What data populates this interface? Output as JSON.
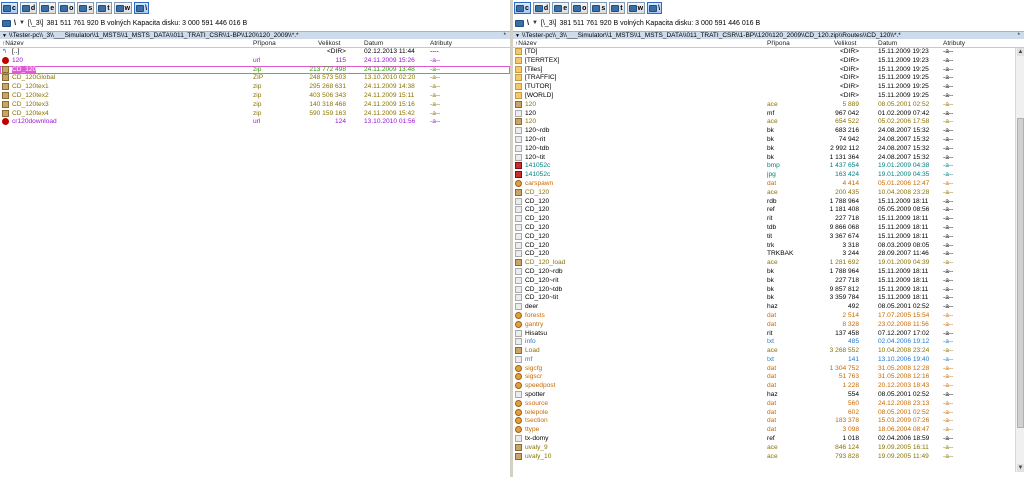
{
  "colors": {
    "default": "#000000",
    "green": "#2a9d00",
    "purple": "#9b14d8",
    "olive": "#8a7300",
    "orange": "#c86a00",
    "blue": "#1f78d0",
    "teal": "#008080"
  },
  "left": {
    "drives": [
      {
        "letter": "c",
        "active": true
      },
      {
        "letter": "d",
        "active": false
      },
      {
        "letter": "e",
        "active": false
      },
      {
        "letter": "o",
        "active": false
      },
      {
        "letter": "s",
        "active": false
      },
      {
        "letter": "t",
        "active": false
      },
      {
        "letter": "w",
        "active": false
      },
      {
        "letter": "\\",
        "active": true
      }
    ],
    "info": {
      "drive_button": "\\",
      "volume_label": "[\\_3\\]",
      "free_text": "381 511 761 920 B volných  Kapacita disku: 3 000 591 446 016 B"
    },
    "path": "\\\\Tester-pc\\\\_3\\\\___Simulator\\\\1_MSTS\\\\1_MSTS_DATA\\\\011_TRATI_CSR\\\\1-BP\\\\120\\\\120_2009\\\\*.*",
    "columns": {
      "name": "Název",
      "ext": "Přípona",
      "size": "Velikost",
      "date": "Datum",
      "attr": "Atributy"
    },
    "rows": [
      {
        "icon": "up",
        "name": "[..]",
        "ext": "",
        "size": "<DIR>",
        "date": "02.12.2013 11:44",
        "attr": "----",
        "color": "default"
      },
      {
        "icon": "url",
        "name": "120",
        "ext": "url",
        "size": "115",
        "date": "24.11.2009 15:26",
        "attr": "-a--",
        "color": "purple"
      },
      {
        "icon": "archive",
        "name": "CD_120",
        "ext": "zip",
        "size": "213 772 498",
        "date": "24.11.2009 13:48",
        "attr": "-a--",
        "color": "green",
        "selected": true
      },
      {
        "icon": "archive",
        "name": "CD_120Global",
        "ext": "ZIP",
        "size": "248 573 503",
        "date": "13.10.2010 02:20",
        "attr": "-a--",
        "color": "olive"
      },
      {
        "icon": "archive",
        "name": "CD_120tex1",
        "ext": "zip",
        "size": "295 268 631",
        "date": "24.11.2009 14:38",
        "attr": "-a--",
        "color": "olive"
      },
      {
        "icon": "archive",
        "name": "CD_120tex2",
        "ext": "zip",
        "size": "403 506 343",
        "date": "24.11.2009 15:11",
        "attr": "-a--",
        "color": "olive"
      },
      {
        "icon": "archive",
        "name": "CD_120tex3",
        "ext": "zip",
        "size": "140 318 468",
        "date": "24.11.2009 15:16",
        "attr": "-a--",
        "color": "olive"
      },
      {
        "icon": "archive",
        "name": "CD_120tex4",
        "ext": "zip",
        "size": "590 159 163",
        "date": "24.11.2009 15:42",
        "attr": "-a--",
        "color": "olive"
      },
      {
        "icon": "url",
        "name": "cr120download",
        "ext": "url",
        "size": "124",
        "date": "13.10.2010 01:56",
        "attr": "-a--",
        "color": "purple"
      }
    ]
  },
  "right": {
    "drives": [
      {
        "letter": "c",
        "active": true
      },
      {
        "letter": "d",
        "active": false
      },
      {
        "letter": "e",
        "active": false
      },
      {
        "letter": "o",
        "active": false
      },
      {
        "letter": "s",
        "active": false
      },
      {
        "letter": "t",
        "active": false
      },
      {
        "letter": "w",
        "active": false
      },
      {
        "letter": "\\",
        "active": true
      }
    ],
    "info": {
      "drive_button": "\\",
      "volume_label": "[\\_3\\]",
      "free_text": "381 511 761 920 B volných  Kapacita disku: 3 000 591 446 016 B"
    },
    "path": "\\\\Tester-pc\\\\_3\\\\___Simulator\\\\1_MSTS\\\\1_MSTS_DATA\\\\011_TRATI_CSR\\\\1-BP\\\\120\\\\120_2009\\\\CD_120.zip\\\\Routes\\\\CD_120\\\\*.*",
    "columns": {
      "name": "Název",
      "ext": "Přípona",
      "size": "Velikost",
      "date": "Datum",
      "attr": "Atributy"
    },
    "rows": [
      {
        "icon": "folder",
        "name": "[TD]",
        "ext": "",
        "size": "<DIR>",
        "date": "15.11.2009 19:23",
        "attr": "-a--",
        "color": "default"
      },
      {
        "icon": "folder",
        "name": "[TERRTEX]",
        "ext": "",
        "size": "<DIR>",
        "date": "15.11.2009 19:23",
        "attr": "-a--",
        "color": "default"
      },
      {
        "icon": "folder",
        "name": "[Tiles]",
        "ext": "",
        "size": "<DIR>",
        "date": "15.11.2009 19:25",
        "attr": "-a--",
        "color": "default"
      },
      {
        "icon": "folder",
        "name": "[TRAFFIC]",
        "ext": "",
        "size": "<DIR>",
        "date": "15.11.2009 19:25",
        "attr": "-a--",
        "color": "default"
      },
      {
        "icon": "folder",
        "name": "[TUTOR]",
        "ext": "",
        "size": "<DIR>",
        "date": "15.11.2009 19:25",
        "attr": "-a--",
        "color": "default"
      },
      {
        "icon": "folder",
        "name": "[WORLD]",
        "ext": "",
        "size": "<DIR>",
        "date": "15.11.2009 19:25",
        "attr": "-a--",
        "color": "default"
      },
      {
        "icon": "archive",
        "name": "120",
        "ext": "ace",
        "size": "5 889",
        "date": "08.05.2001 02:52",
        "attr": "-a--",
        "color": "olive"
      },
      {
        "icon": "doc",
        "name": "120",
        "ext": "mf",
        "size": "967 042",
        "date": "01.02.2009 07:42",
        "attr": "-a--",
        "color": "default"
      },
      {
        "icon": "archive",
        "name": "120",
        "ext": "ace",
        "size": "654 522",
        "date": "05.02.2006 17:58",
        "attr": "-a--",
        "color": "olive"
      },
      {
        "icon": "doc",
        "name": "120~rdb",
        "ext": "bk",
        "size": "683 216",
        "date": "24.08.2007 15:32",
        "attr": "-a--",
        "color": "default"
      },
      {
        "icon": "doc",
        "name": "120~rit",
        "ext": "bk",
        "size": "74 942",
        "date": "24.08.2007 15:32",
        "attr": "-a--",
        "color": "default"
      },
      {
        "icon": "doc",
        "name": "120~tdb",
        "ext": "bk",
        "size": "2 992 112",
        "date": "24.08.2007 15:32",
        "attr": "-a--",
        "color": "default"
      },
      {
        "icon": "doc",
        "name": "120~tit",
        "ext": "bk",
        "size": "1 131 364",
        "date": "24.08.2007 15:32",
        "attr": "-a--",
        "color": "default"
      },
      {
        "icon": "image",
        "name": "141052c",
        "ext": "bmp",
        "size": "1 437 654",
        "date": "19.01.2009 04:38",
        "attr": "-a--",
        "color": "teal"
      },
      {
        "icon": "image",
        "name": "141052c",
        "ext": "jpg",
        "size": "163 424",
        "date": "19.01.2009 04:35",
        "attr": "-a--",
        "color": "teal"
      },
      {
        "icon": "sound",
        "name": "carspawn",
        "ext": "dat",
        "size": "4 414",
        "date": "05.01.2006 12:47",
        "attr": "-a--",
        "color": "orange"
      },
      {
        "icon": "archive",
        "name": "CD_120",
        "ext": "ace",
        "size": "200 435",
        "date": "10.04.2008 23:28",
        "attr": "-a--",
        "color": "olive"
      },
      {
        "icon": "doc",
        "name": "CD_120",
        "ext": "rdb",
        "size": "1 788 964",
        "date": "15.11.2009 18:11",
        "attr": "-a--",
        "color": "default"
      },
      {
        "icon": "doc",
        "name": "CD_120",
        "ext": "ref",
        "size": "1 181 408",
        "date": "05.05.2009 08:56",
        "attr": "-a--",
        "color": "default"
      },
      {
        "icon": "doc",
        "name": "CD_120",
        "ext": "rit",
        "size": "227 718",
        "date": "15.11.2009 18:11",
        "attr": "-a--",
        "color": "default"
      },
      {
        "icon": "doc",
        "name": "CD_120",
        "ext": "tdb",
        "size": "9 866 068",
        "date": "15.11.2009 18:11",
        "attr": "-a--",
        "color": "default"
      },
      {
        "icon": "doc",
        "name": "CD_120",
        "ext": "tit",
        "size": "3 367 674",
        "date": "15.11.2009 18:11",
        "attr": "-a--",
        "color": "default"
      },
      {
        "icon": "doc",
        "name": "CD_120",
        "ext": "trk",
        "size": "3 318",
        "date": "08.03.2009 08:05",
        "attr": "-a--",
        "color": "default"
      },
      {
        "icon": "doc",
        "name": "CD_120",
        "ext": "TRKBAK",
        "size": "3 244",
        "date": "28.09.2007 11:46",
        "attr": "-a--",
        "color": "default"
      },
      {
        "icon": "archive",
        "name": "CD_120_load",
        "ext": "ace",
        "size": "1 281 692",
        "date": "19.01.2009 04:39",
        "attr": "-a--",
        "color": "olive"
      },
      {
        "icon": "doc",
        "name": "CD_120~rdb",
        "ext": "bk",
        "size": "1 788 964",
        "date": "15.11.2009 18:11",
        "attr": "-a--",
        "color": "default"
      },
      {
        "icon": "doc",
        "name": "CD_120~rit",
        "ext": "bk",
        "size": "227 718",
        "date": "15.11.2009 18:11",
        "attr": "-a--",
        "color": "default"
      },
      {
        "icon": "doc",
        "name": "CD_120~tdb",
        "ext": "bk",
        "size": "9 857 812",
        "date": "15.11.2009 18:11",
        "attr": "-a--",
        "color": "default"
      },
      {
        "icon": "doc",
        "name": "CD_120~tit",
        "ext": "bk",
        "size": "3 359 784",
        "date": "15.11.2009 18:11",
        "attr": "-a--",
        "color": "default"
      },
      {
        "icon": "doc",
        "name": "deer",
        "ext": "haz",
        "size": "492",
        "date": "08.05.2001 02:52",
        "attr": "-a--",
        "color": "default"
      },
      {
        "icon": "sound",
        "name": "forests",
        "ext": "dat",
        "size": "2 514",
        "date": "17.07.2005 15:54",
        "attr": "-a--",
        "color": "orange"
      },
      {
        "icon": "sound",
        "name": "gantry",
        "ext": "dat",
        "size": "8 328",
        "date": "23.02.2008 11:56",
        "attr": "-a--",
        "color": "orange"
      },
      {
        "icon": "doc",
        "name": "Hisatsu",
        "ext": "rit",
        "size": "137 458",
        "date": "07.12.2007 17:02",
        "attr": "-a--",
        "color": "default"
      },
      {
        "icon": "doc",
        "name": "info",
        "ext": "txt",
        "size": "485",
        "date": "02.04.2006 19:12",
        "attr": "-a--",
        "color": "blue"
      },
      {
        "icon": "archive",
        "name": "Load",
        "ext": "ace",
        "size": "3 268 552",
        "date": "10.04.2008 23:24",
        "attr": "-a--",
        "color": "olive"
      },
      {
        "icon": "doc",
        "name": "mf",
        "ext": "txt",
        "size": "141",
        "date": "13.10.2006 19:40",
        "attr": "-a--",
        "color": "blue"
      },
      {
        "icon": "sound",
        "name": "sigcfg",
        "ext": "dat",
        "size": "1 304 752",
        "date": "31.05.2008 12:28",
        "attr": "-a--",
        "color": "orange"
      },
      {
        "icon": "sound",
        "name": "sigscr",
        "ext": "dat",
        "size": "51 763",
        "date": "31.05.2008 12:16",
        "attr": "-a--",
        "color": "orange"
      },
      {
        "icon": "sound",
        "name": "speedpost",
        "ext": "dat",
        "size": "1 228",
        "date": "20.12.2003 18:43",
        "attr": "-a--",
        "color": "orange"
      },
      {
        "icon": "doc",
        "name": "spotter",
        "ext": "haz",
        "size": "554",
        "date": "08.05.2001 02:52",
        "attr": "-a--",
        "color": "default"
      },
      {
        "icon": "sound",
        "name": "ssource",
        "ext": "dat",
        "size": "560",
        "date": "24.12.2008 23:13",
        "attr": "-a--",
        "color": "orange"
      },
      {
        "icon": "sound",
        "name": "telepole",
        "ext": "dat",
        "size": "602",
        "date": "08.05.2001 02:52",
        "attr": "-a--",
        "color": "orange"
      },
      {
        "icon": "sound",
        "name": "tsection",
        "ext": "dat",
        "size": "183 378",
        "date": "15.03.2009 07:26",
        "attr": "-a--",
        "color": "orange"
      },
      {
        "icon": "sound",
        "name": "ttype",
        "ext": "dat",
        "size": "3 098",
        "date": "18.06.2004 08:47",
        "attr": "-a--",
        "color": "orange"
      },
      {
        "icon": "doc",
        "name": "tx-domy",
        "ext": "ref",
        "size": "1 018",
        "date": "02.04.2006 18:59",
        "attr": "-a--",
        "color": "default"
      },
      {
        "icon": "archive",
        "name": "uvaly_9",
        "ext": "ace",
        "size": "846 124",
        "date": "19.09.2005 16:11",
        "attr": "-a--",
        "color": "olive"
      },
      {
        "icon": "archive",
        "name": "uvaly_10",
        "ext": "ace",
        "size": "793 828",
        "date": "19.09.2005 11:49",
        "attr": "-a--",
        "color": "olive"
      }
    ]
  }
}
